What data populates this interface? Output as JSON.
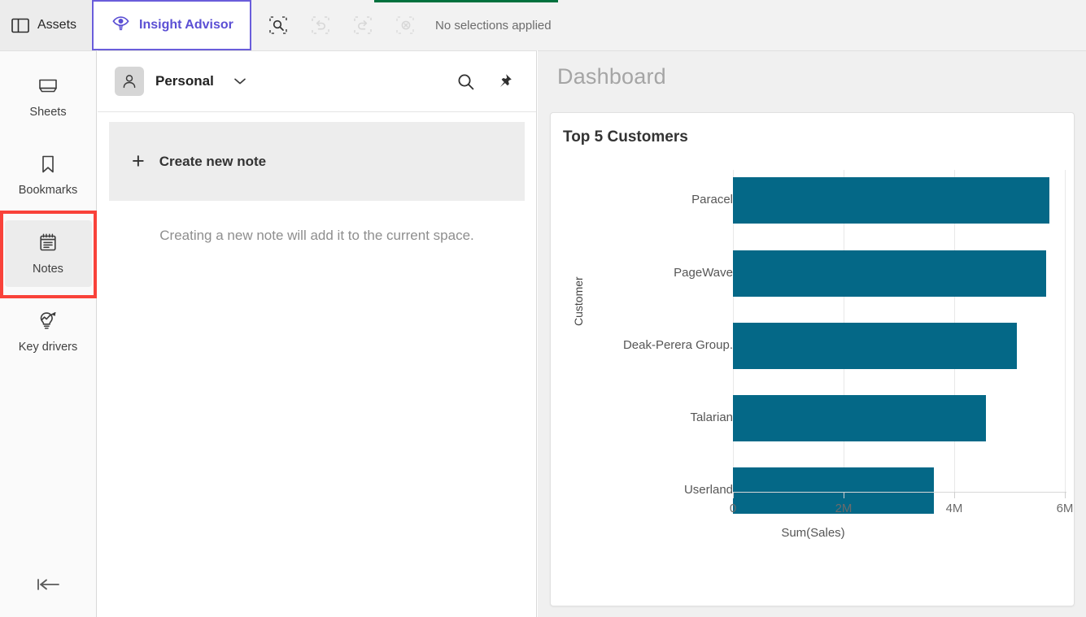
{
  "topbar": {
    "assets": {
      "label": "Assets",
      "icon": "panel-layout-icon"
    },
    "insight_advisor": {
      "label": "Insight Advisor",
      "icon": "eye-bulb-icon",
      "accent": "#5b4fd4"
    },
    "progress_color": "#00713e",
    "selection_tools": [
      {
        "name": "selection-search",
        "icon": "selection-search-icon",
        "enabled": true
      },
      {
        "name": "selection-undo",
        "icon": "undo-icon",
        "enabled": false
      },
      {
        "name": "selection-redo",
        "icon": "redo-icon",
        "enabled": false
      },
      {
        "name": "selection-clear-all",
        "icon": "clear-selections-icon",
        "enabled": false
      }
    ],
    "selection_status": "No selections applied"
  },
  "sidebar": {
    "items": [
      {
        "label": "Sheets",
        "icon": "sheets-icon",
        "active": false
      },
      {
        "label": "Bookmarks",
        "icon": "bookmark-icon",
        "active": false
      },
      {
        "label": "Notes",
        "icon": "notes-icon",
        "active": true
      },
      {
        "label": "Key drivers",
        "icon": "key-drivers-icon",
        "active": false
      }
    ],
    "active_accent": "#00873c",
    "highlight_color": "#f9423a",
    "collapse": {
      "label": "",
      "icon": "collapse-left-icon"
    }
  },
  "notes": {
    "space": {
      "name": "Personal",
      "avatar_icon": "person-icon",
      "chevron": "chevron-down-icon"
    },
    "header_actions": [
      {
        "name": "search-notes",
        "icon": "search-icon"
      },
      {
        "name": "pin-notes",
        "icon": "pin-icon"
      }
    ],
    "create_button": {
      "label": "Create new note",
      "icon": "plus-icon"
    },
    "hint": "Creating a new note will add it to the current space."
  },
  "dashboard": {
    "title": "Dashboard"
  },
  "chart_data": {
    "type": "bar",
    "orientation": "horizontal",
    "title": "Top 5 Customers",
    "xlabel": "Sum(Sales)",
    "ylabel": "Customer",
    "categories": [
      "Paracel",
      "PageWave",
      "Deak-Perera Group.",
      "Talarian",
      "Userland"
    ],
    "values": [
      5720000,
      5660000,
      5130000,
      4570000,
      3630000
    ],
    "xlim": [
      0,
      6000000
    ],
    "xticks": [
      0,
      2000000,
      4000000,
      6000000
    ],
    "xticklabels": [
      "0",
      "2M",
      "4M",
      "6M"
    ],
    "grid": true,
    "legend": false,
    "bar_color": "#046887"
  }
}
